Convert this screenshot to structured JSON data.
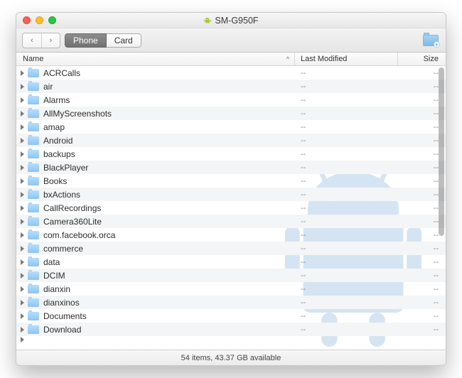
{
  "window": {
    "title": "SM-G950F"
  },
  "toolbar": {
    "back_glyph": "‹",
    "forward_glyph": "›",
    "tab_phone": "Phone",
    "tab_card": "Card"
  },
  "columns": {
    "name": "Name",
    "sort_glyph": "^",
    "modified": "Last Modified",
    "size": "Size"
  },
  "dash": "--",
  "rows": [
    {
      "name": "ACRCalls"
    },
    {
      "name": "air"
    },
    {
      "name": "Alarms"
    },
    {
      "name": "AllMyScreenshots"
    },
    {
      "name": "amap"
    },
    {
      "name": "Android"
    },
    {
      "name": "backups"
    },
    {
      "name": "BlackPlayer"
    },
    {
      "name": "Books"
    },
    {
      "name": "bxActions"
    },
    {
      "name": "CallRecordings"
    },
    {
      "name": "Camera360Lite"
    },
    {
      "name": "com.facebook.orca"
    },
    {
      "name": "commerce"
    },
    {
      "name": "data"
    },
    {
      "name": "DCIM"
    },
    {
      "name": "dianxin"
    },
    {
      "name": "dianxinos"
    },
    {
      "name": "Documents"
    },
    {
      "name": "Download"
    }
  ],
  "status": "54 items, 43.37 GB available"
}
